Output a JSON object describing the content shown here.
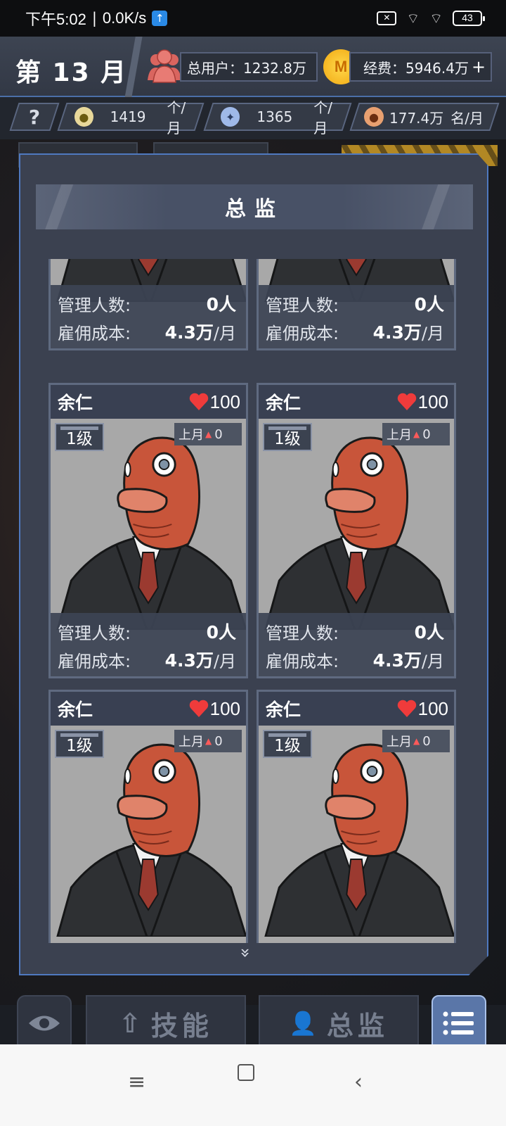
{
  "status_bar": {
    "time": "下午5:02",
    "net_speed": "0.0K/s",
    "battery": "43"
  },
  "header": {
    "month": "第 13 月",
    "users_label": "总用户：",
    "users_value": "1232.8万",
    "funds_label": "经费：",
    "funds_value": "5946.4万",
    "funds_add": "+",
    "coin_letter": "M"
  },
  "stats": {
    "help": "?",
    "ideas_value": "1419",
    "ideas_unit": "个/月",
    "tools_value": "1365",
    "tools_unit": "个/月",
    "people_value": "177.4万",
    "people_unit": "名/月"
  },
  "modal": {
    "title": "总监",
    "partial_cards": [
      {
        "manage_label": "管理人数:",
        "manage_value": "0人",
        "cost_label": "雇佣成本:",
        "cost_value": "4.3万",
        "cost_unit": "/月"
      },
      {
        "manage_label": "管理人数:",
        "manage_value": "0人",
        "cost_label": "雇佣成本:",
        "cost_value": "4.3万",
        "cost_unit": "/月"
      }
    ],
    "cards": [
      {
        "name": "余仁",
        "hp": "100",
        "level": "1级",
        "last_month_label": "上月",
        "last_month_value": "0",
        "manage_label": "管理人数:",
        "manage_value": "0人",
        "cost_label": "雇佣成本:",
        "cost_value": "4.3万",
        "cost_unit": "/月"
      },
      {
        "name": "余仁",
        "hp": "100",
        "level": "1级",
        "last_month_label": "上月",
        "last_month_value": "0",
        "manage_label": "管理人数:",
        "manage_value": "0人",
        "cost_label": "雇佣成本:",
        "cost_value": "4.3万",
        "cost_unit": "/月"
      },
      {
        "name": "余仁",
        "hp": "100",
        "level": "1级",
        "last_month_label": "上月",
        "last_month_value": "0"
      },
      {
        "name": "余仁",
        "hp": "100",
        "level": "1级",
        "last_month_label": "上月",
        "last_month_value": "0"
      }
    ],
    "more_indicator": "»"
  },
  "bottom": {
    "skill_label": "技能",
    "director_label": "总监"
  },
  "colors": {
    "accent_blue": "#4f79c0",
    "heart_red": "#ef3b3b",
    "coin_gold": "#f1a812",
    "fish_orange": "#c8553a"
  },
  "icons": [
    "users-icon",
    "coin-icon",
    "help-icon",
    "bulb-icon",
    "wrench-icon",
    "person-icon",
    "heart-icon",
    "eye-icon",
    "menu-icon"
  ]
}
